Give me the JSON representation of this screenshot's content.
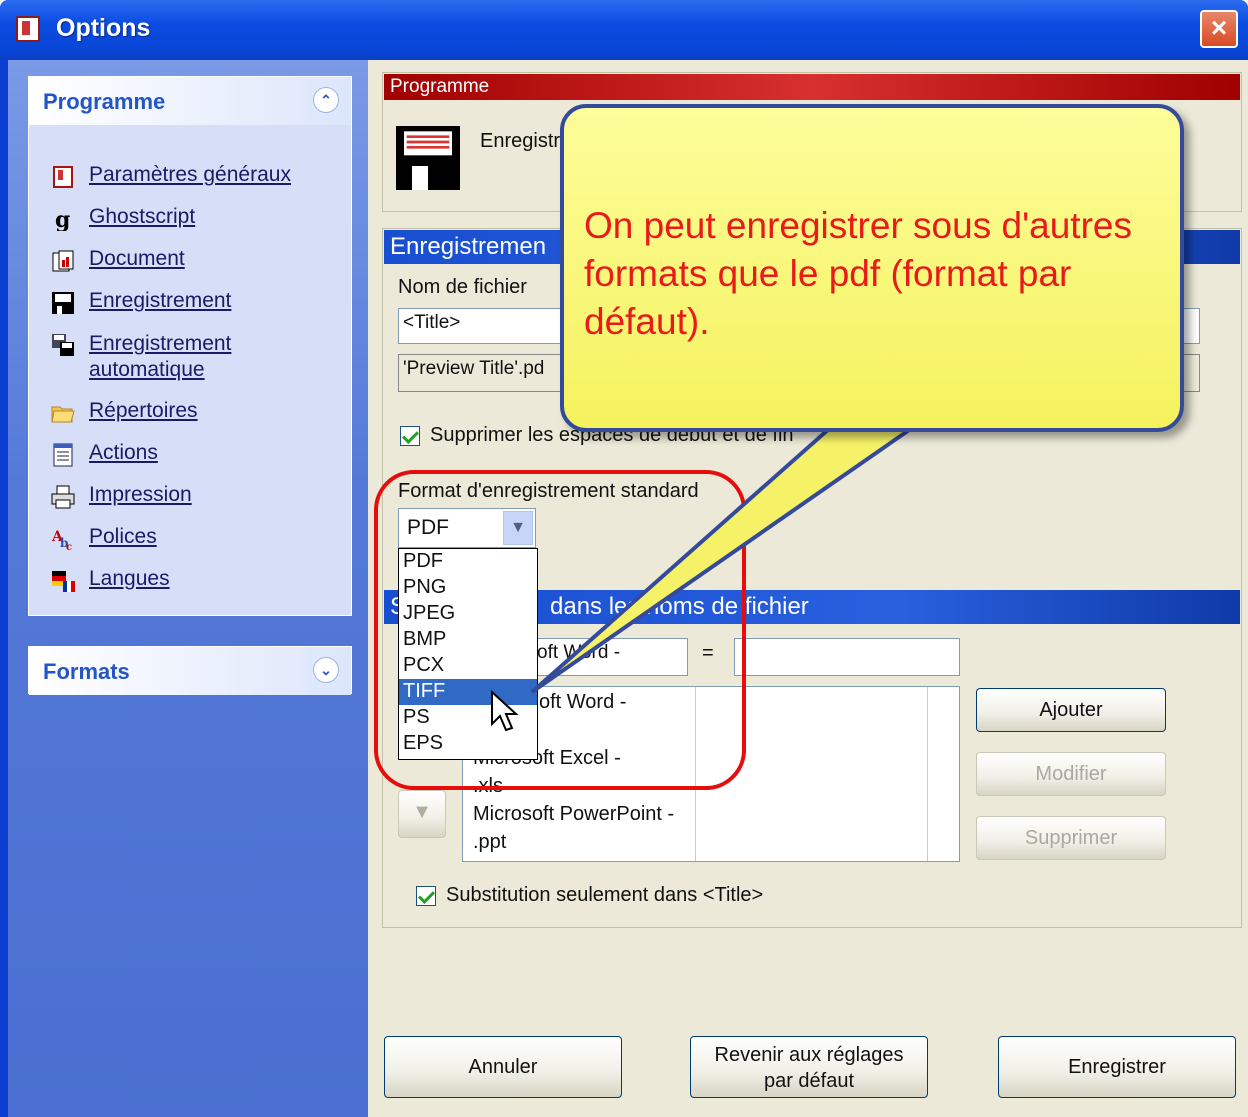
{
  "window": {
    "title": "Options",
    "close": "×"
  },
  "sidebar": {
    "program_group": "Programme",
    "formats_group": "Formats",
    "items": [
      {
        "label": "Paramètres généraux",
        "icon": "general-settings-icon"
      },
      {
        "label": "Ghostscript",
        "icon": "ghostscript-icon"
      },
      {
        "label": "Document",
        "icon": "document-icon"
      },
      {
        "label": "Enregistrement",
        "icon": "floppy-disk-icon"
      },
      {
        "label": "Enregistrement",
        "label2": "automatique",
        "icon": "auto-save-icon"
      },
      {
        "label": "Répertoires",
        "icon": "folders-icon"
      },
      {
        "label": "Actions",
        "icon": "actions-icon"
      },
      {
        "label": "Impression",
        "icon": "printer-icon"
      },
      {
        "label": "Polices",
        "icon": "fonts-icon"
      },
      {
        "label": "Langues",
        "icon": "flags-icon"
      }
    ]
  },
  "program_section": {
    "header": "Programme",
    "caption": "Enregistr"
  },
  "save_section": {
    "header": "Enregistremen",
    "filename_label": "Nom de fichier",
    "filename_value": "<Title>",
    "preview_value": "'Preview Title'.pd",
    "trim_label": "Supprimer les espaces de début et de fin",
    "format_label": "Format d'enregistrement standard",
    "format_value": "PDF",
    "format_options": [
      "PDF",
      "PNG",
      "JPEG",
      "BMP",
      "PCX",
      "TIFF",
      "PS",
      "EPS"
    ],
    "format_selected": "TIFF"
  },
  "subst_section": {
    "header": "S         dans les noms de fichier",
    "header_left": "S",
    "header_right": "dans les noms de fichier",
    "from_value": "oft Word -",
    "equals": "=",
    "to_value": "",
    "rows": [
      "oft Word -",
      "Microsoft Excel -",
      ".xls",
      "Microsoft PowerPoint -",
      ".ppt"
    ],
    "only_title_label": "Substitution seulement dans <Title>",
    "add": "Ajouter",
    "modify": "Modifier",
    "delete": "Supprimer"
  },
  "footer": {
    "cancel": "Annuler",
    "defaults_line1": "Revenir aux réglages",
    "defaults_line2": "par défaut",
    "save": "Enregistrer"
  },
  "callout": {
    "text": "On peut enregistrer sous d'autres formats que le pdf (format par défaut)."
  }
}
